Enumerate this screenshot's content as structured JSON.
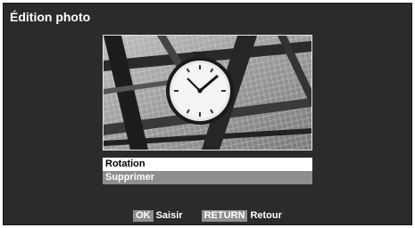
{
  "header": {
    "title": "Édition photo"
  },
  "photo": {
    "subject": "clock-photo"
  },
  "menu": {
    "items": [
      {
        "label": "Rotation",
        "selected": true
      },
      {
        "label": "Supprimer",
        "selected": false
      }
    ]
  },
  "footer": {
    "hints": [
      {
        "key": "OK",
        "label": "Saisir"
      },
      {
        "key": "RETURN",
        "label": "Retour"
      }
    ]
  },
  "colors": {
    "background": "#2b2b2b",
    "selected_bg": "#ffffff",
    "item_bg": "#8e8e8e",
    "key_bg": "#8e8e8e"
  }
}
